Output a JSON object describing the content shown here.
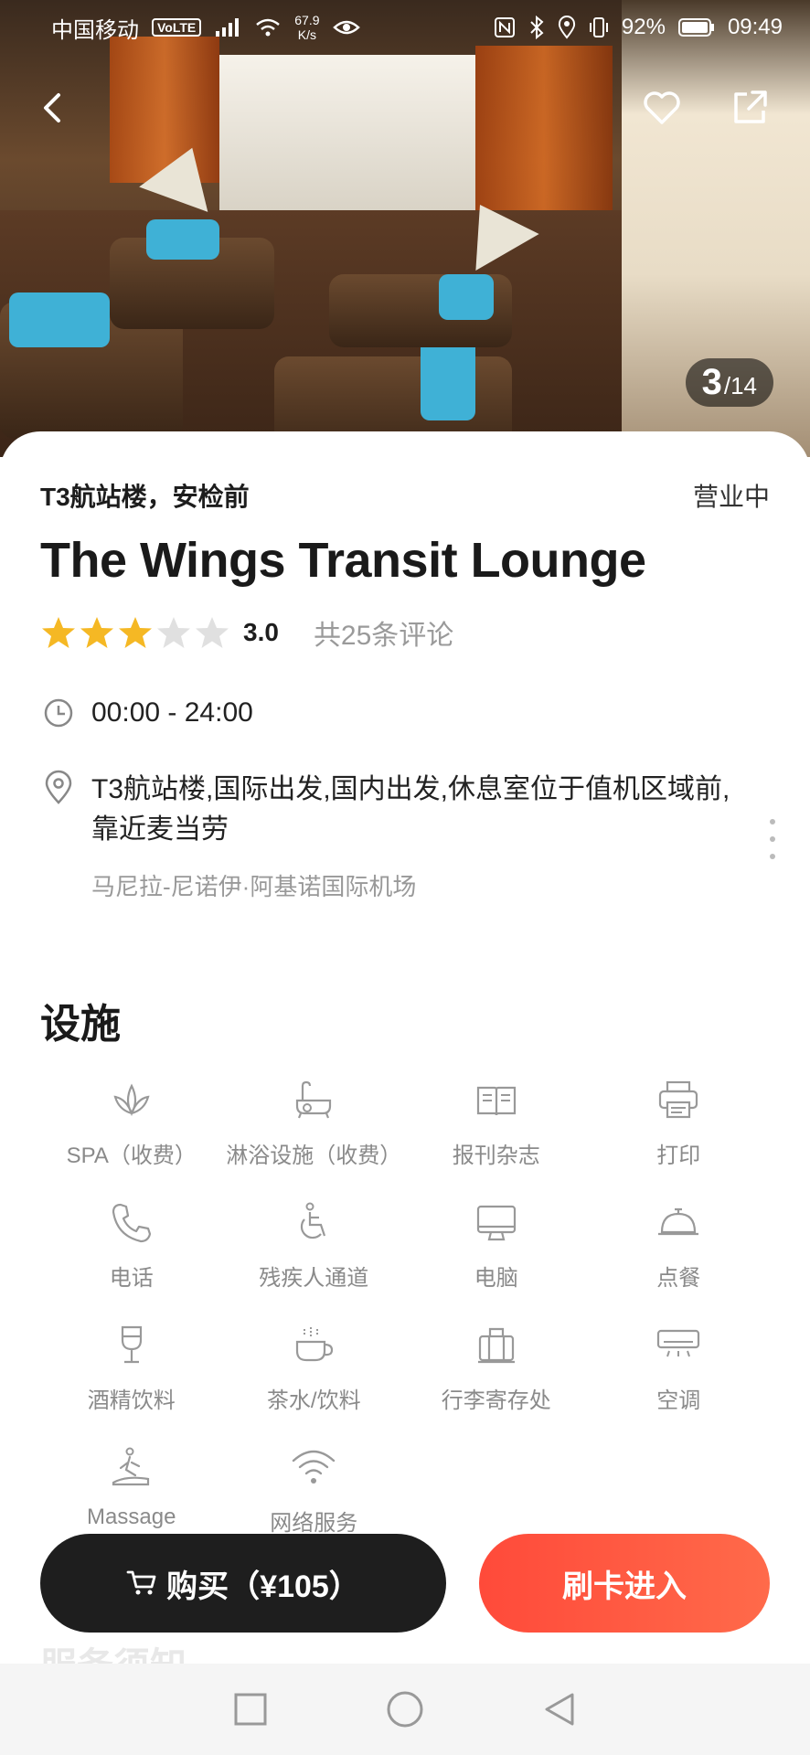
{
  "status_bar": {
    "carrier": "中国移动",
    "volte": "VoLTE",
    "speed_value": "67.9",
    "speed_unit": "K/s",
    "battery": "92%",
    "time": "09:49"
  },
  "gallery": {
    "current": "3",
    "total": "/14"
  },
  "lounge": {
    "location": "T3航站楼，安检前",
    "status": "营业中",
    "name": "The Wings Transit Lounge",
    "rating": 3.0,
    "rating_text": "3.0",
    "reviews": "共25条评论",
    "hours": "00:00 - 24:00",
    "address": "T3航站楼,国际出发,国内出发,休息室位于值机区域前,靠近麦当劳",
    "airport": "马尼拉-尼诺伊·阿基诺国际机场"
  },
  "facilities_title": "设施",
  "facilities": [
    {
      "label": "SPA（收费）",
      "icon": "lotus-icon"
    },
    {
      "label": "淋浴设施（收费）",
      "icon": "bathtub-icon"
    },
    {
      "label": "报刊杂志",
      "icon": "book-icon"
    },
    {
      "label": "打印",
      "icon": "printer-icon"
    },
    {
      "label": "电话",
      "icon": "phone-icon"
    },
    {
      "label": "残疾人通道",
      "icon": "wheelchair-icon"
    },
    {
      "label": "电脑",
      "icon": "monitor-icon"
    },
    {
      "label": "点餐",
      "icon": "food-bell-icon"
    },
    {
      "label": "酒精饮料",
      "icon": "wine-glass-icon"
    },
    {
      "label": "茶水/饮料",
      "icon": "coffee-cup-icon"
    },
    {
      "label": "行李寄存处",
      "icon": "luggage-icon"
    },
    {
      "label": "空调",
      "icon": "air-conditioner-icon"
    },
    {
      "label": "Massage",
      "icon": "massage-icon"
    },
    {
      "label": "网络服务",
      "icon": "wifi-icon"
    }
  ],
  "service_notice": "服务须知",
  "actions": {
    "buy_label": "购买（¥105）",
    "enter_label": "刷卡进入"
  },
  "colors": {
    "accent": "#ff4a3a",
    "star": "#f5b824",
    "star_empty": "#e0e0e0"
  }
}
